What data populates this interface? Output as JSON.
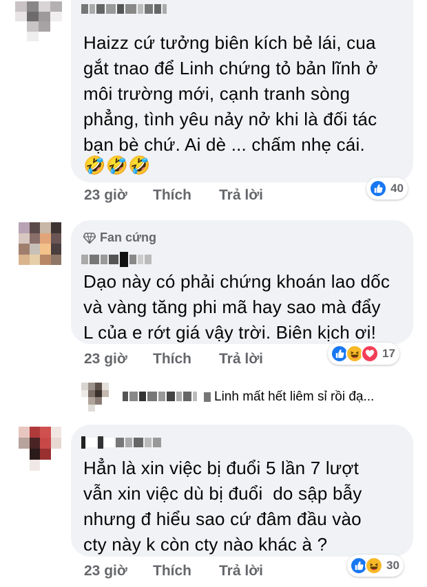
{
  "comments": [
    {
      "text_lines": [
        "Haizz cứ tưởng biên kích bẻ lái, cua",
        "gắt tnao để Linh chứng tỏ bản lĩnh ở",
        "môi trường mới, cạnh tranh sòng",
        "phẳng, tình yêu nảy nở khi là đối tác",
        "bạn bè chứ. Ai dè ... chấm nhẹ cái."
      ],
      "emoji_row": "🤣🤣🤣",
      "time": "23 giờ",
      "like_label": "Thích",
      "reply_label": "Trả lời",
      "reaction_count": "40",
      "reactions": [
        "like-icon"
      ]
    },
    {
      "badge": "Fan cứng",
      "text_lines": [
        "Dạo này có phải chứng khoán lao dốc",
        "và vàng tăng phi mã hay sao mà đẩy",
        "L của e rớt giá vậy trời. Biên kịch ơi!"
      ],
      "time": "23 giờ",
      "like_label": "Thích",
      "reply_label": "Trả lời",
      "reaction_count": "17",
      "reactions": [
        "like-icon",
        "haha-icon",
        "love-icon"
      ],
      "reply_preview": "Linh mất hết liêm sỉ rồi đạ..."
    },
    {
      "text_lines": [
        "Hẳn là xin việc bị đuổi 5 lần 7 lượt",
        "vẫn xin việc dù bị đuổi  do sập bẫy",
        "nhưng đ hiểu sao cứ đâm đầu vào",
        "cty này k còn cty nào khác à ?"
      ],
      "time": "23 giờ",
      "like_label": "Thích",
      "reply_label": "Trả lời",
      "reaction_count": "30",
      "reactions": [
        "like-icon",
        "haha-icon"
      ]
    }
  ],
  "colors": {
    "bubble": "#f0f2f5",
    "meta": "#65676b",
    "like": "#1877f2",
    "love": "#f33e58",
    "haha": "#f7b928"
  }
}
